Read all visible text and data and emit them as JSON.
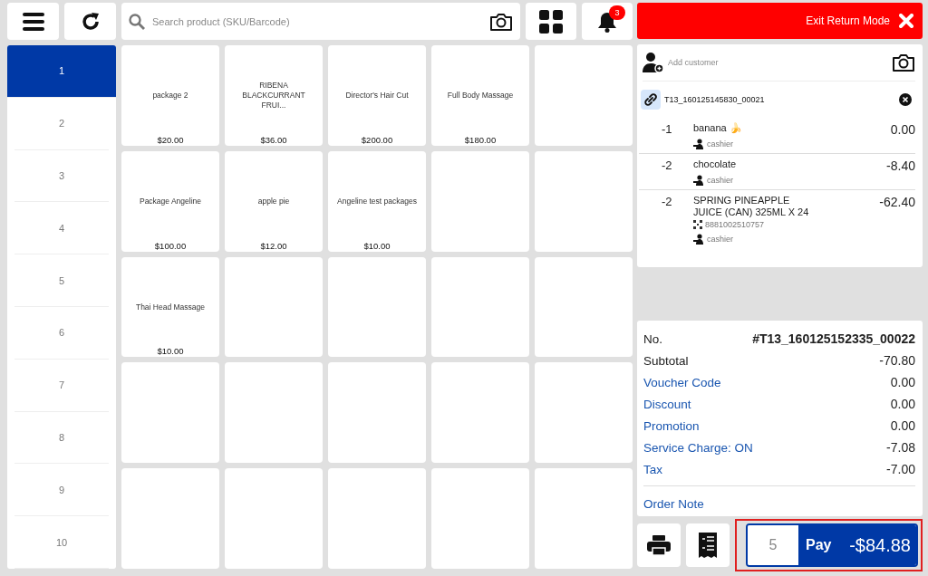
{
  "search": {
    "placeholder": "Search product (SKU/Barcode)"
  },
  "notifications": {
    "badge": "3"
  },
  "exit_button": {
    "label": "Exit Return Mode"
  },
  "pages": [
    {
      "label": "1",
      "selected": true
    },
    {
      "label": "2",
      "selected": false
    },
    {
      "label": "3",
      "selected": false
    },
    {
      "label": "4",
      "selected": false
    },
    {
      "label": "5",
      "selected": false
    },
    {
      "label": "6",
      "selected": false
    },
    {
      "label": "7",
      "selected": false
    },
    {
      "label": "8",
      "selected": false
    },
    {
      "label": "9",
      "selected": false
    },
    {
      "label": "10",
      "selected": false
    }
  ],
  "products": [
    {
      "kind": "product",
      "name": "package 2",
      "price": "$20.00"
    },
    {
      "kind": "product",
      "name": "RIBENA BLACKCURRANT FRUI...",
      "price": "$36.00"
    },
    {
      "kind": "product",
      "name": "Director's Hair Cut",
      "price": "$200.00"
    },
    {
      "kind": "product",
      "name": "Full Body Massage",
      "price": "$180.00"
    },
    {
      "kind": "empty"
    },
    {
      "kind": "product",
      "name": "Package Angeline",
      "price": "$100.00"
    },
    {
      "kind": "product",
      "name": "apple pie",
      "price": "$12.00"
    },
    {
      "kind": "product",
      "name": "Angeline test packages",
      "price": "$10.00"
    },
    {
      "kind": "empty"
    },
    {
      "kind": "empty"
    },
    {
      "kind": "product",
      "name": "Thai Head Massage",
      "price": "$10.00"
    }
  ],
  "customer": {
    "placeholder": "Add customer"
  },
  "linked_order": {
    "reference": "T13_160125145830_00021"
  },
  "order_items": [
    {
      "qty": "-1",
      "name": "banana 🍌",
      "price": "0.00",
      "staff": "cashier"
    },
    {
      "qty": "-2",
      "name": "chocolate",
      "price": "-8.40",
      "staff": "cashier"
    },
    {
      "qty": "-2",
      "name": "SPRING PINEAPPLE JUICE (CAN) 325ML X 24",
      "price": "-62.40",
      "barcode": "8881002510757",
      "staff": "cashier"
    }
  ],
  "totals": [
    {
      "label": "No.",
      "value": "#T13_160125152335_00022",
      "kind": "number"
    },
    {
      "label": "Subtotal",
      "value": "-70.80",
      "kind": "plain"
    },
    {
      "label": "Voucher Code",
      "value": "0.00",
      "kind": "action"
    },
    {
      "label": "Discount",
      "value": "0.00",
      "kind": "action"
    },
    {
      "label": "Promotion",
      "value": "0.00",
      "kind": "action"
    },
    {
      "label": "Service Charge: ON",
      "value": "-7.08",
      "kind": "action"
    },
    {
      "label": "Tax",
      "value": "-7.00",
      "kind": "action"
    }
  ],
  "order_note": {
    "label": "Order Note"
  },
  "payment": {
    "quantity": "5",
    "label": "Pay",
    "amount": "-$84.88",
    "highlighted": true
  }
}
